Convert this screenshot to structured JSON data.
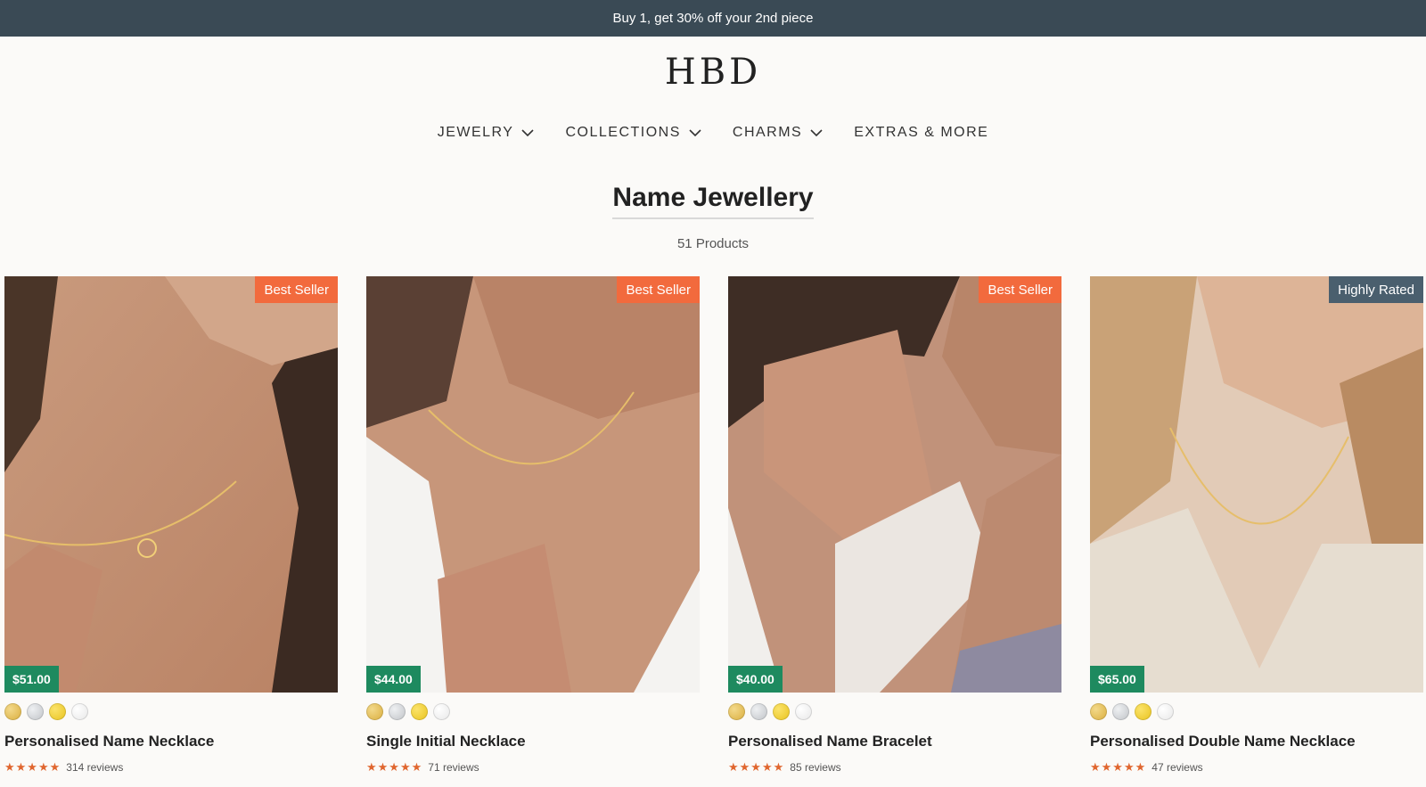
{
  "announcement": "Buy 1, get 30% off your 2nd piece",
  "brand": {
    "logo_text": "HBD"
  },
  "nav": [
    {
      "label": "JEWELRY",
      "has_dropdown": true
    },
    {
      "label": "COLLECTIONS",
      "has_dropdown": true
    },
    {
      "label": "CHARMS",
      "has_dropdown": true
    },
    {
      "label": "EXTRAS & MORE",
      "has_dropdown": false
    }
  ],
  "page": {
    "title": "Name Jewellery",
    "product_count": "51 Products"
  },
  "products": [
    {
      "name": "Personalised Name Necklace",
      "price": "$51.00",
      "badge": "Best Seller",
      "rating": 5,
      "stars": "★★★★★",
      "reviews": "314 reviews",
      "swatches": [
        "gold",
        "silver",
        "yellow-gold",
        "white-silver"
      ]
    },
    {
      "name": "Single Initial Necklace",
      "price": "$44.00",
      "badge": "Best Seller",
      "rating": 5,
      "stars": "★★★★★",
      "reviews": "71 reviews",
      "swatches": [
        "gold",
        "silver",
        "yellow-gold",
        "white-silver"
      ]
    },
    {
      "name": "Personalised Name Bracelet",
      "price": "$40.00",
      "badge": "Best Seller",
      "rating": 5,
      "stars": "★★★★★",
      "reviews": "85 reviews",
      "swatches": [
        "gold",
        "silver",
        "yellow-gold",
        "white-silver"
      ]
    },
    {
      "name": "Personalised Double Name Necklace",
      "price": "$65.00",
      "badge": "Highly Rated",
      "rating": 5,
      "stars": "★★★★★",
      "reviews": "47 reviews",
      "swatches": [
        "gold",
        "silver",
        "yellow-gold",
        "white-silver"
      ]
    }
  ],
  "colors": {
    "announcement_bg": "#3a4a55",
    "best_seller_badge": "#f26a3d",
    "highly_rated_badge": "#4a5f6e",
    "price_tag": "#1e8a5f",
    "stars": "#e0662f",
    "swatch_gold": "#d9ad3c",
    "swatch_silver": "#bfc2c6",
    "swatch_yellow_gold": "#e8c21c",
    "swatch_white_silver": "#e6e6e6"
  },
  "icons": {
    "nav_dropdown": "chevron-down-icon",
    "rating": "star-icon"
  }
}
